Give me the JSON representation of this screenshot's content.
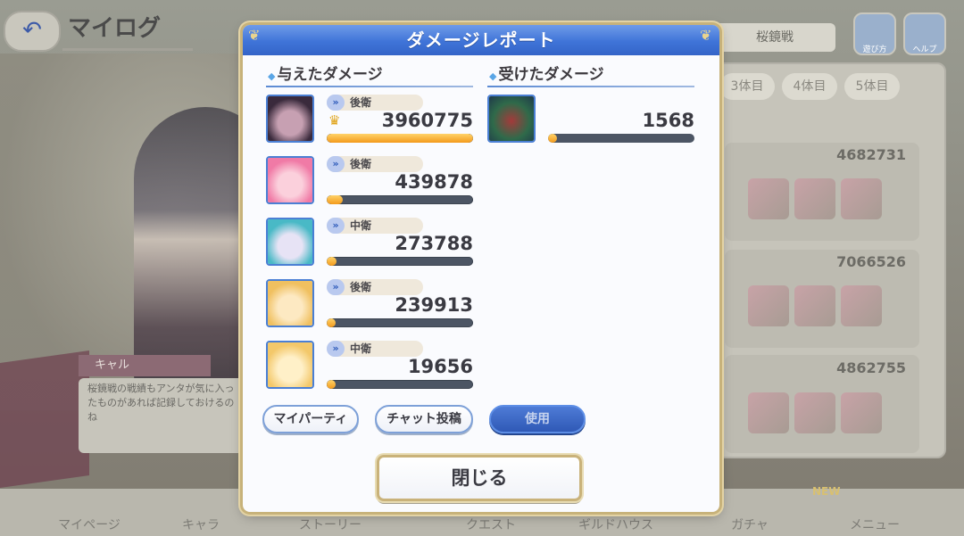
{
  "background": {
    "screen_title": "マイログ",
    "back_icon": "back-arrow-icon",
    "field_label": "桜鏡戦",
    "top_buttons": [
      {
        "label": "遊び方",
        "icon": "info-icon"
      },
      {
        "label": "ヘルプ",
        "icon": "help-icon"
      }
    ],
    "tabs": [
      "3体目",
      "4体目",
      "5体目"
    ],
    "rows": [
      {
        "value": "4682731"
      },
      {
        "value": "7066526"
      },
      {
        "value": "4862755"
      }
    ],
    "speaker": "キャル",
    "dialog_text": "桜鏡戦の戦績もアンタが気に入ったものがあれば記録しておけるのね",
    "bottom_nav": [
      "マイページ",
      "キャラ",
      "ストーリー",
      "クエスト",
      "ギルドハウス",
      "ガチャ",
      "メニュー"
    ],
    "badge": "NEW"
  },
  "modal": {
    "title": "ダメージレポート",
    "dealt_title": "与えたダメージ",
    "received_title": "受けたダメージ",
    "dealt": [
      {
        "position": "後衛",
        "damage": "3960775",
        "ratio": 1.0,
        "crown": true,
        "portrait_colors": [
          "#3a2a3c",
          "#c7a0b2"
        ]
      },
      {
        "position": "後衛",
        "damage": "439878",
        "ratio": 0.111,
        "crown": false,
        "portrait_colors": [
          "#f07aa6",
          "#fbd0dc"
        ]
      },
      {
        "position": "中衛",
        "damage": "273788",
        "ratio": 0.069,
        "crown": false,
        "portrait_colors": [
          "#49b9c6",
          "#e7e3f5"
        ]
      },
      {
        "position": "後衛",
        "damage": "239913",
        "ratio": 0.061,
        "crown": false,
        "portrait_colors": [
          "#f0c060",
          "#fde9c2"
        ]
      },
      {
        "position": "中衛",
        "damage": "19656",
        "ratio": 0.005,
        "crown": false,
        "portrait_colors": [
          "#f3c86a",
          "#fff0c8"
        ]
      }
    ],
    "received": [
      {
        "damage": "1568",
        "ratio": 0.0004,
        "portrait_colors": [
          "#2f6a4a",
          "#a33a3a"
        ]
      }
    ],
    "buttons": {
      "my_party": "マイパーティ",
      "chat_post": "チャット投稿",
      "use": "使用",
      "close": "閉じる"
    },
    "colors": {
      "header": "#3f74d8",
      "bar_fill": "#f39a1b",
      "bar_track": "#4c5564",
      "frame": "#c7b27a"
    }
  }
}
